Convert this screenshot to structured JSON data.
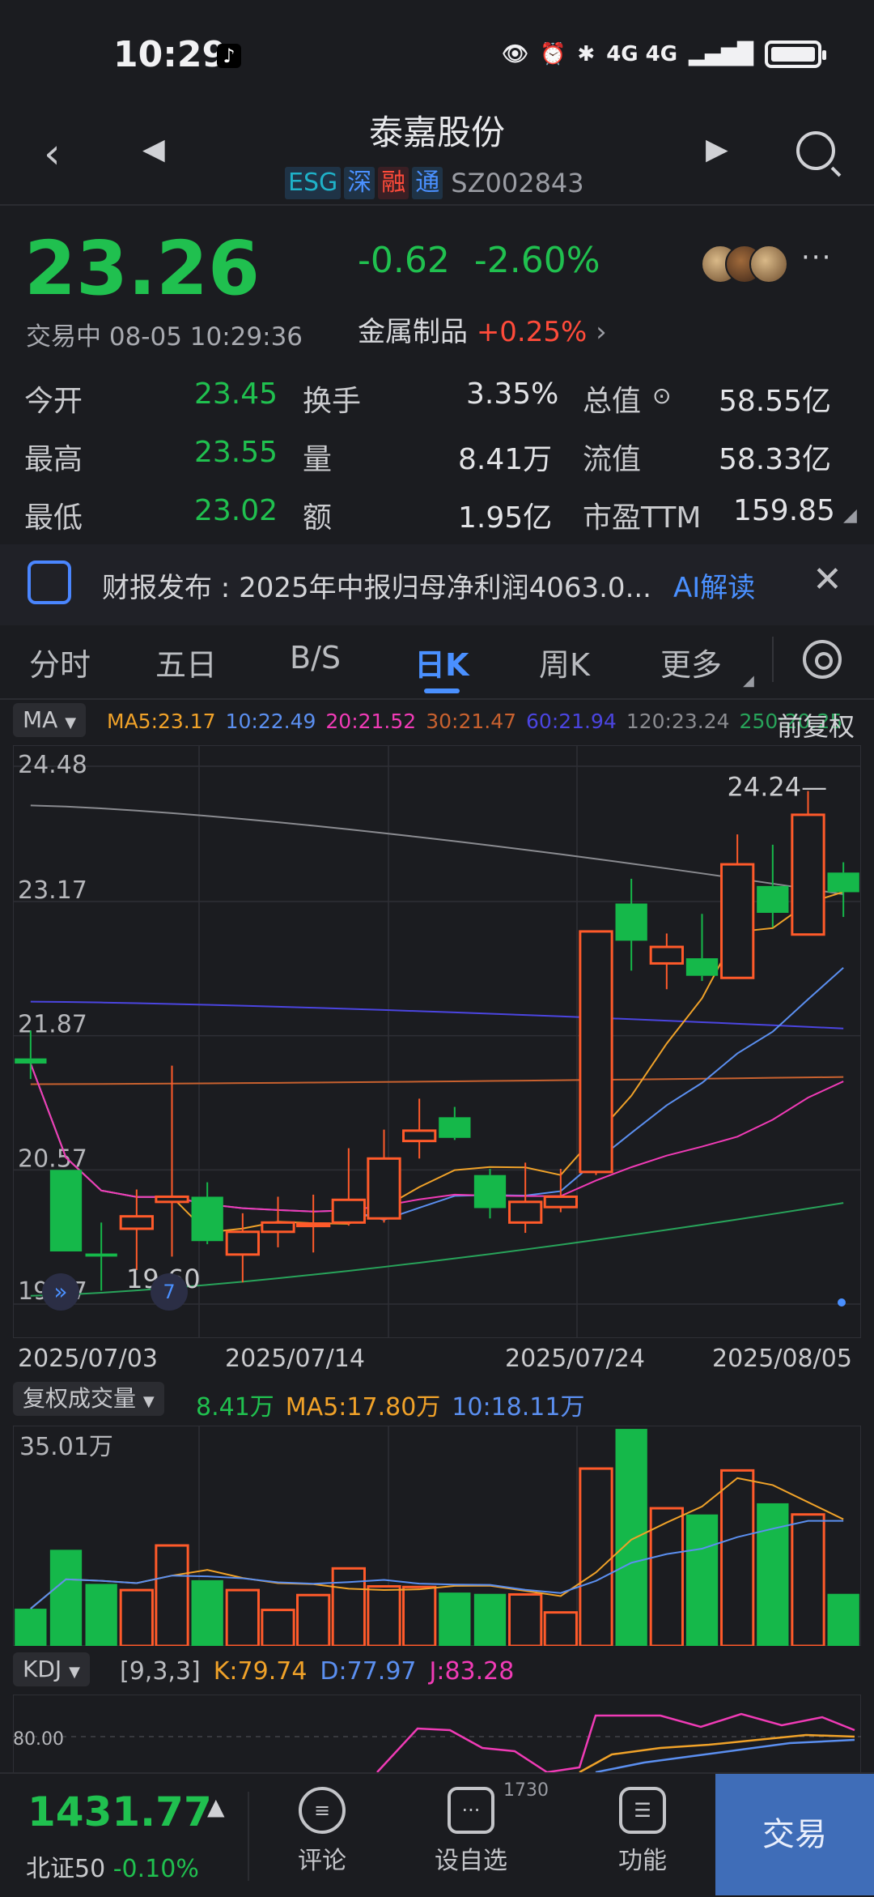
{
  "status": {
    "time": "10:29",
    "network": "4G 4G"
  },
  "header": {
    "title": "泰嘉股份",
    "tags": [
      "ESG",
      "深",
      "融",
      "通"
    ],
    "code": "SZ002843"
  },
  "quote": {
    "price": "23.26",
    "trade_time": "交易中 08-05 10:29:36",
    "change": "-0.62",
    "change_pct": "-2.60%",
    "industry": "金属制品",
    "industry_pct": "+0.25%",
    "rows": [
      {
        "l1": "今开",
        "v1": "23.45",
        "l2": "换手",
        "v2": "3.35%",
        "l3": "总值",
        "v3": "58.55亿"
      },
      {
        "l1": "最高",
        "v1": "23.55",
        "l2": "量",
        "v2": "8.41万",
        "l3": "流值",
        "v3": "58.33亿"
      },
      {
        "l1": "最低",
        "v1": "23.02",
        "l2": "额",
        "v2": "1.95亿",
        "l3": "市盈TTM",
        "v3": "159.85"
      }
    ]
  },
  "banner": {
    "text": "财报发布 : 2025年中报归母净利润4063.0...",
    "ai": "AI解读"
  },
  "tabs": [
    "分时",
    "五日",
    "B/S",
    "日K",
    "周K",
    "更多"
  ],
  "ma_bar": {
    "chip": "MA",
    "items": [
      {
        "label": "MA5:23.17",
        "color": "#f0a229"
      },
      {
        "label": "10:22.49",
        "color": "#5b8ff0"
      },
      {
        "label": "20:21.52",
        "color": "#f03bb6"
      },
      {
        "label": "30:21.47",
        "color": "#c8612f"
      },
      {
        "label": "60:21.94",
        "color": "#4b45e0"
      },
      {
        "label": "120:23.24",
        "color": "#8a8b90"
      },
      {
        "label": "250:20.25",
        "color": "#28a35a"
      }
    ],
    "adjust": "前复权"
  },
  "vol_bar": {
    "chip": "复权成交量",
    "v": "8.41万",
    "ma5": "MA5:17.80万",
    "ma10": "10:18.11万"
  },
  "kdj_bar": {
    "chip": "KDJ",
    "params": "[9,3,3]",
    "k": "K:79.74",
    "d": "D:77.97",
    "j": "J:83.28"
  },
  "bottom": {
    "index_value": "1431.77",
    "index_name": "北证50",
    "index_pct": "-0.10%",
    "items": [
      "评论",
      "设自选",
      "功能"
    ],
    "badge": "1730",
    "trade": "交易"
  },
  "chart_data": {
    "type": "candlestick",
    "y_ticks": [
      "24.48",
      "23.17",
      "21.87",
      "20.57",
      "19.27"
    ],
    "ylim": [
      19.27,
      24.48
    ],
    "x_labels": [
      "2025/07/03",
      "2025/07/14",
      "2025/07/24",
      "2025/08/05"
    ],
    "max_label": "24.24",
    "min_label": "19.60",
    "candles": [
      {
        "o": 21.65,
        "c": 21.6,
        "h": 21.92,
        "l": 21.45
      },
      {
        "o": 20.57,
        "c": 19.78,
        "h": 20.57,
        "l": 19.78
      },
      {
        "o": 19.76,
        "c": 19.73,
        "h": 20.06,
        "l": 19.4
      },
      {
        "o": 20.0,
        "c": 20.12,
        "h": 20.38,
        "l": 19.6
      },
      {
        "o": 20.26,
        "c": 20.31,
        "h": 21.58,
        "l": 19.73
      },
      {
        "o": 20.31,
        "c": 19.88,
        "h": 20.45,
        "l": 19.85
      },
      {
        "o": 19.75,
        "c": 19.97,
        "h": 20.15,
        "l": 19.48
      },
      {
        "o": 19.97,
        "c": 20.06,
        "h": 20.31,
        "l": 19.82
      },
      {
        "o": 20.03,
        "c": 20.05,
        "h": 20.33,
        "l": 19.77
      },
      {
        "o": 20.06,
        "c": 20.28,
        "h": 20.78,
        "l": 20.03
      },
      {
        "o": 20.1,
        "c": 20.68,
        "h": 20.96,
        "l": 20.06
      },
      {
        "o": 20.85,
        "c": 20.95,
        "h": 21.26,
        "l": 20.68
      },
      {
        "o": 21.08,
        "c": 20.88,
        "h": 21.18,
        "l": 20.86
      },
      {
        "o": 20.52,
        "c": 20.2,
        "h": 20.58,
        "l": 20.1
      },
      {
        "o": 20.06,
        "c": 20.26,
        "h": 20.64,
        "l": 19.96
      },
      {
        "o": 20.21,
        "c": 20.31,
        "h": 20.58,
        "l": 20.16
      },
      {
        "o": 20.55,
        "c": 22.88,
        "h": 22.88,
        "l": 20.52
      },
      {
        "o": 23.15,
        "c": 22.79,
        "h": 23.39,
        "l": 22.5
      },
      {
        "o": 22.57,
        "c": 22.73,
        "h": 22.86,
        "l": 22.32
      },
      {
        "o": 22.62,
        "c": 22.45,
        "h": 23.05,
        "l": 22.4
      },
      {
        "o": 22.43,
        "c": 23.53,
        "h": 23.82,
        "l": 22.43
      },
      {
        "o": 23.32,
        "c": 23.06,
        "h": 23.72,
        "l": 22.92
      },
      {
        "o": 22.85,
        "c": 24.01,
        "h": 24.24,
        "l": 22.85
      },
      {
        "o": 23.45,
        "c": 23.26,
        "h": 23.55,
        "l": 23.02
      }
    ],
    "volume": {
      "ymax_label": "35.01万",
      "values": [
        6.0,
        15.5,
        10.0,
        9.0,
        16.2,
        10.6,
        9.0,
        5.8,
        8.2,
        12.5,
        9.6,
        9.5,
        8.6,
        8.4,
        8.3,
        5.4,
        28.6,
        35.0,
        22.2,
        21.2,
        28.3,
        23.0,
        21.2,
        8.4
      ]
    },
    "kdj": {
      "ref_line": "80.00"
    }
  }
}
